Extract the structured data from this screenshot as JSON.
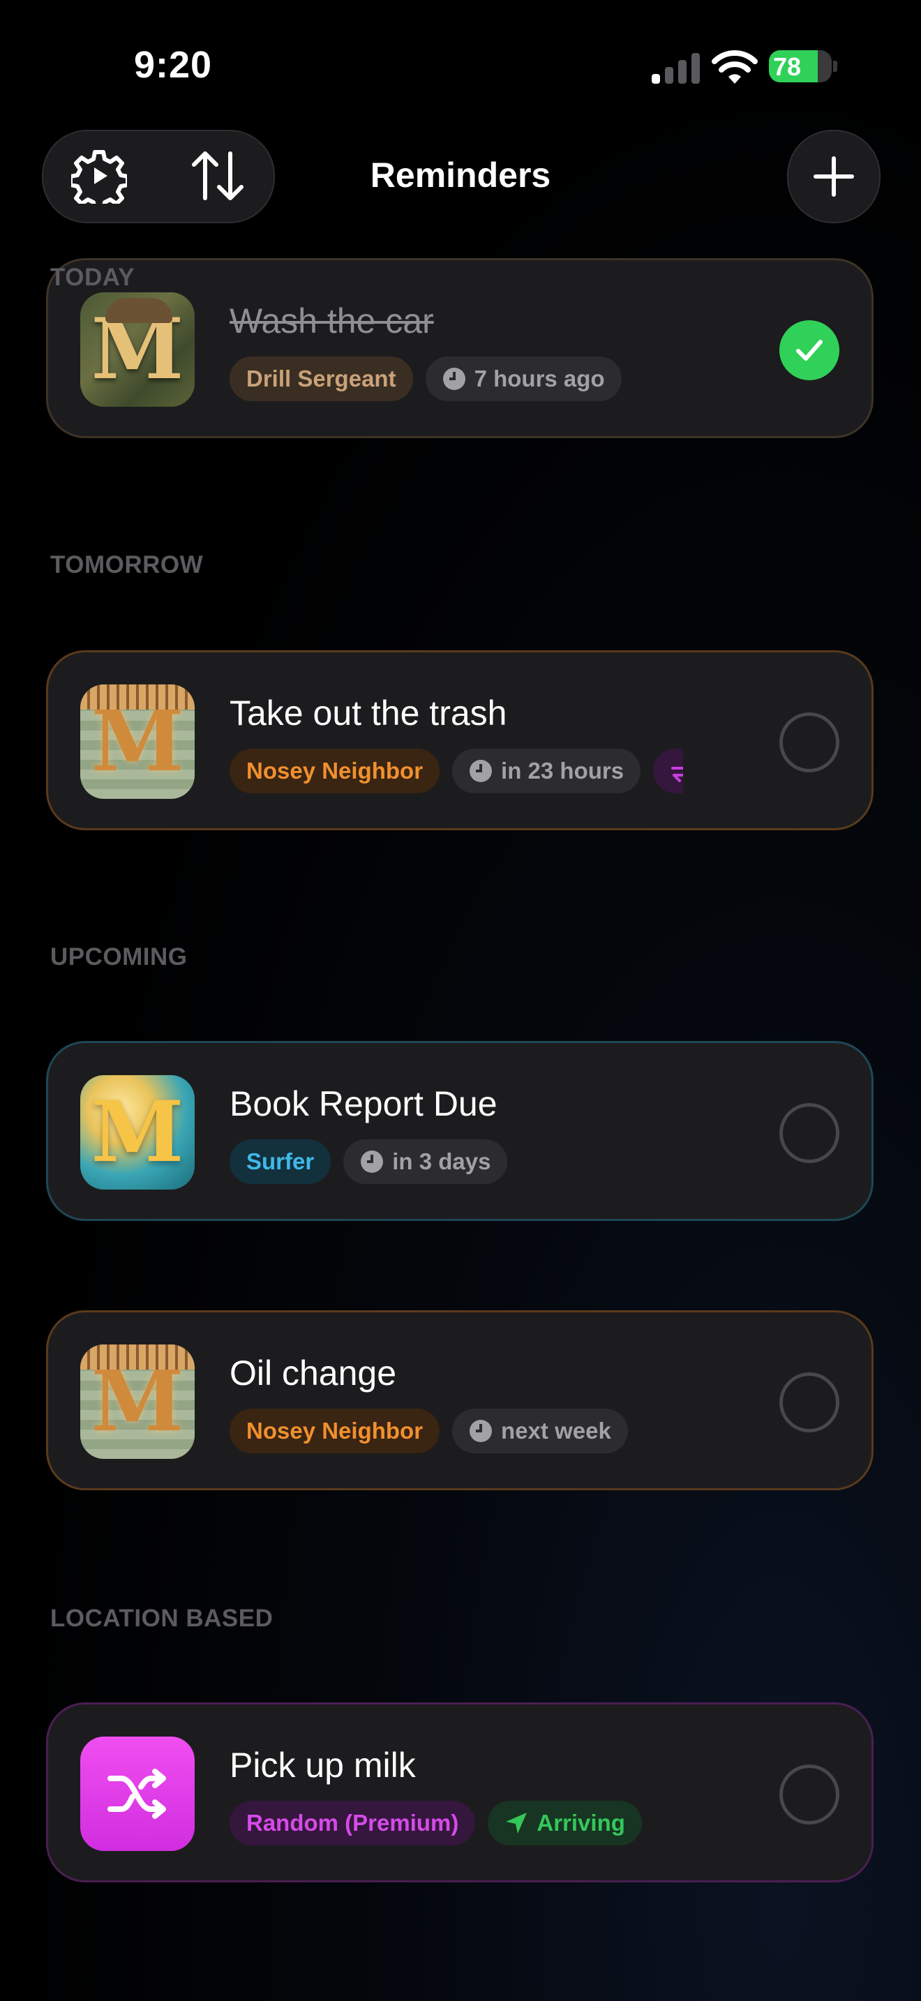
{
  "status_bar": {
    "time": "9:20",
    "battery": "78",
    "battery_level": 0.78
  },
  "header": {
    "title": "Reminders"
  },
  "sections": [
    {
      "label": "TODAY",
      "items": [
        {
          "title": "Wash the car",
          "completed": true,
          "persona": "Drill Sergeant",
          "persona_color": "#c9a27a",
          "persona_bg": "#3a2e22",
          "time": "7 hours ago",
          "avatar_icon": "camo-m-avatar-icon"
        }
      ]
    },
    {
      "label": "TOMORROW",
      "items": [
        {
          "title": "Take out the trash",
          "completed": false,
          "persona": "Nosey Neighbor",
          "persona_color": "#f0902e",
          "persona_bg": "#3a2412",
          "time": "in 23 hours",
          "repeat": true,
          "avatar_icon": "wood-m-avatar-icon"
        }
      ]
    },
    {
      "label": "UPCOMING",
      "items": [
        {
          "title": "Book Report Due",
          "completed": false,
          "persona": "Surfer",
          "persona_color": "#3fb9e8",
          "persona_bg": "#13303d",
          "time": "in 3 days",
          "avatar_icon": "wave-m-avatar-icon"
        },
        {
          "title": "Oil change",
          "completed": false,
          "persona": "Nosey Neighbor",
          "persona_color": "#f0902e",
          "persona_bg": "#3a2412",
          "time": "next week",
          "avatar_icon": "wood-m-avatar-icon"
        }
      ]
    },
    {
      "label": "LOCATION BASED",
      "items": [
        {
          "title": "Pick up milk",
          "completed": false,
          "persona": "Random (Premium)",
          "persona_color": "#d44be8",
          "persona_bg": "#35163c",
          "trigger": "Arriving",
          "trigger_color": "#34c759",
          "trigger_bg": "#173522",
          "avatar_icon": "shuffle-icon"
        }
      ]
    }
  ],
  "colors": {
    "done_check": "#30d158",
    "repeat_chip": "#c83fe0"
  }
}
